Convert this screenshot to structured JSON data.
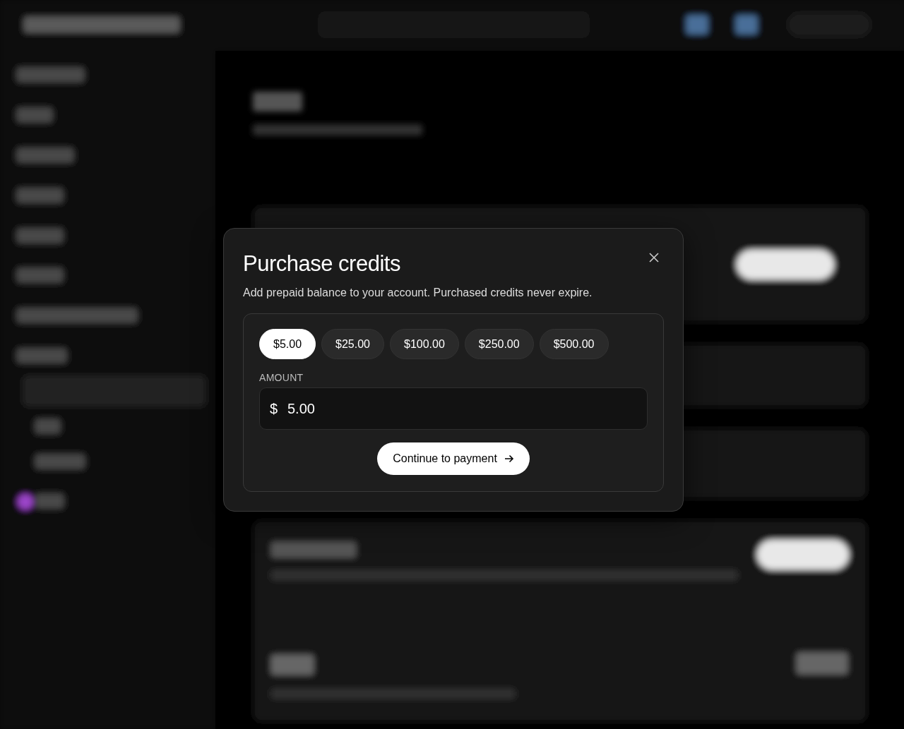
{
  "dialog": {
    "title": "Purchase credits",
    "description": "Add prepaid balance to your account. Purchased credits never expire.",
    "presets": [
      {
        "label": "$5.00",
        "selected": true
      },
      {
        "label": "$25.00",
        "selected": false
      },
      {
        "label": "$100.00",
        "selected": false
      },
      {
        "label": "$250.00",
        "selected": false
      },
      {
        "label": "$500.00",
        "selected": false
      }
    ],
    "amount_label": "AMOUNT",
    "currency": "$",
    "amount": "5.00",
    "continue_label": "Continue to payment"
  }
}
